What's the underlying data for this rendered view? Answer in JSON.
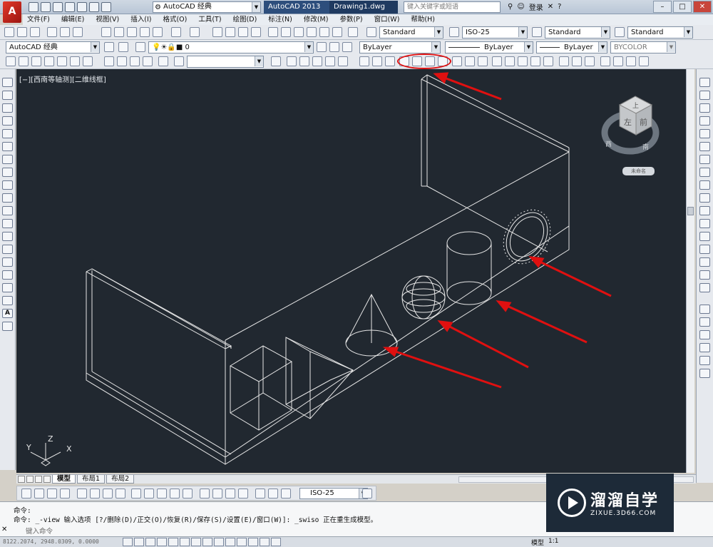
{
  "titlebar": {
    "workspace": "AutoCAD 经典",
    "app_name": "AutoCAD 2013",
    "document": "Drawing1.dwg",
    "help_search_placeholder": "键入关键字或短语",
    "login": "登录"
  },
  "menu": [
    "文件(F)",
    "编辑(E)",
    "视图(V)",
    "插入(I)",
    "格式(O)",
    "工具(T)",
    "绘图(D)",
    "标注(N)",
    "修改(M)",
    "参数(P)",
    "窗口(W)",
    "帮助(H)"
  ],
  "styles_toolbar": {
    "text_style": "Standard",
    "dim_style": "ISO-25",
    "table_style": "Standard",
    "mleader_style": "Standard"
  },
  "layers_toolbar": {
    "workspace": "AutoCAD 经典",
    "layer": "0",
    "color": "ByLayer",
    "linetype": "ByLayer",
    "lineweight": "ByLayer",
    "plotstyle": "BYCOLOR"
  },
  "viewport": {
    "label": "[−][西南等轴测][二维线框]",
    "named_view": "未命名"
  },
  "viewcube": {
    "top": "上",
    "left": "左",
    "front": "前",
    "west": "西",
    "south": "南"
  },
  "ucs": {
    "x": "X",
    "y": "Y",
    "z": "Z"
  },
  "layout_tabs": [
    "模型",
    "布局1",
    "布局2"
  ],
  "dim_toolbar": {
    "dim_style": "ISO-25"
  },
  "command": {
    "line1": "命令:",
    "line2": "命令: _-view 输入选项 [?/删除(D)/正交(O)/恢复(R)/保存(S)/设置(E)/窗口(W)]: _swiso 正在重生成模型。",
    "placeholder": "键入命令"
  },
  "statusbar": {
    "coords": "8122.2074, 2948.0309, 0.0000",
    "model": "模型",
    "scale": "1:1"
  },
  "watermark": {
    "title": "溜溜自学",
    "url": "ZIXUE.3D66.COM"
  },
  "colors": {
    "viewport_bg": "#212830",
    "wire": "#e6e6e6",
    "arrow": "#e01010"
  }
}
